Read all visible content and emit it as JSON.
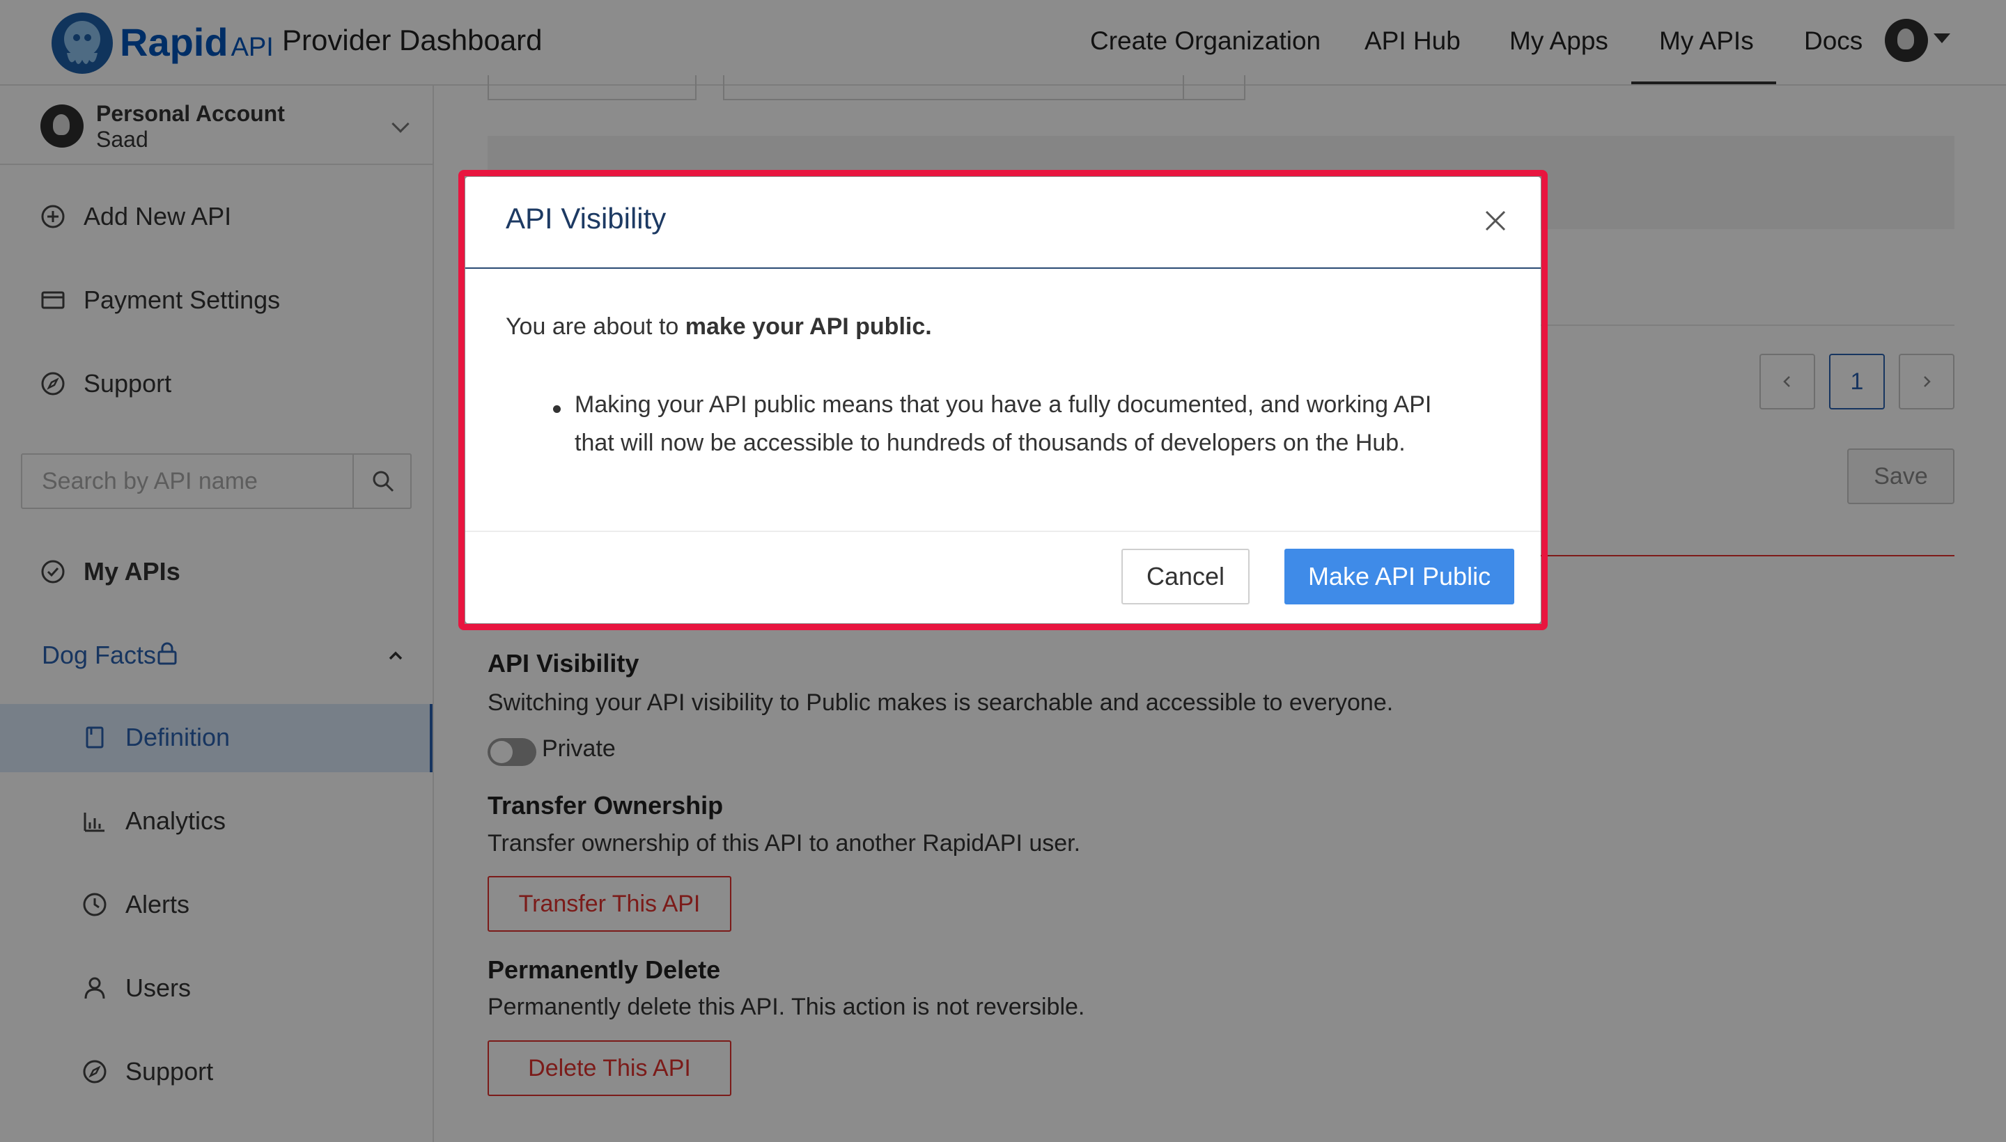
{
  "header": {
    "brand_rapid": "Rapid",
    "brand_api": "API",
    "title": "Provider Dashboard",
    "nav": [
      "Create Organization",
      "API Hub",
      "My Apps",
      "My APIs",
      "Docs"
    ],
    "active_nav": "My APIs"
  },
  "sidebar": {
    "account_name": "Personal Account",
    "account_user": "Saad",
    "add_new_api": "Add New API",
    "payment_settings": "Payment Settings",
    "support": "Support",
    "search_placeholder": "Search by API name",
    "my_apis": "My APIs",
    "api_name": "Dog Facts",
    "sub_items": [
      "Definition",
      "Analytics",
      "Alerts",
      "Users",
      "Support"
    ],
    "active_sub_item": "Definition"
  },
  "main": {
    "pager_current": "1",
    "save_label": "Save",
    "visibility_title": "API Visibility",
    "visibility_desc": "Switching your API visibility to Public makes is searchable and accessible to everyone.",
    "visibility_state": "Private",
    "transfer_title": "Transfer Ownership",
    "transfer_desc": "Transfer ownership of this API to another RapidAPI user.",
    "transfer_button": "Transfer This API",
    "delete_title": "Permanently Delete",
    "delete_desc": "Permanently delete this API. This action is not reversible.",
    "delete_button": "Delete This API"
  },
  "modal": {
    "title": "API Visibility",
    "lead_prefix": "You are about to ",
    "lead_bold": "make your API public.",
    "bullet_line1": "Making your API public means that you have a fully documented, and working API",
    "bullet_line2": "that will now be accessible to hundreds of thousands of developers on the Hub.",
    "cancel_label": "Cancel",
    "confirm_label": "Make API Public"
  },
  "colors": {
    "primary": "#3f8be8",
    "highlight": "#e8153f",
    "danger": "#e0322f",
    "active_bg": "#d9e7f7"
  },
  "icons": [
    "rapidapi-logo-icon",
    "user-avatar-icon",
    "plus-circle-icon",
    "card-icon",
    "compass-icon",
    "search-icon",
    "check-circle-icon",
    "lock-icon",
    "chevron-up-icon",
    "book-icon",
    "bar-chart-icon",
    "clock-icon",
    "user-icon",
    "close-icon"
  ]
}
